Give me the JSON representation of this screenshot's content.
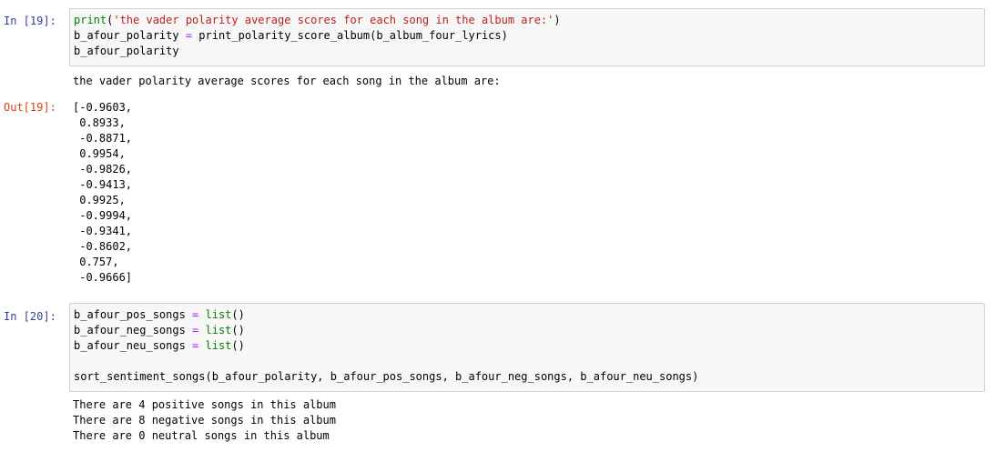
{
  "cell19": {
    "in_prompt": "In [19]:",
    "code": {
      "l1_fn": "print",
      "l1_open": "(",
      "l1_str": "'the vader polarity average scores for each song in the album are:'",
      "l1_close": ")",
      "l2_var": "b_afour_polarity ",
      "l2_eq": "=",
      "l2_rest": " print_polarity_score_album(b_album_four_lyrics)",
      "l3": "b_afour_polarity"
    },
    "stdout": "the vader polarity average scores for each song in the album are:",
    "out_prompt": "Out[19]:",
    "out_lines": [
      "[-0.9603,",
      " 0.8933,",
      " -0.8871,",
      " 0.9954,",
      " -0.9826,",
      " -0.9413,",
      " 0.9925,",
      " -0.9994,",
      " -0.9341,",
      " -0.8602,",
      " 0.757,",
      " -0.9666]"
    ]
  },
  "cell20": {
    "in_prompt": "In [20]:",
    "code": {
      "l1_var": "b_afour_pos_songs ",
      "l2_var": "b_afour_neg_songs ",
      "l3_var": "b_afour_neu_songs ",
      "eq": "=",
      "list_call": " list",
      "parens": "()",
      "l5": "sort_sentiment_songs(b_afour_polarity, b_afour_pos_songs, b_afour_neg_songs, b_afour_neu_songs)"
    },
    "stdout_lines": [
      "There are 4 positive songs in this album",
      "There are 8 negative songs in this album",
      "There are 0 neutral songs in this album"
    ]
  }
}
